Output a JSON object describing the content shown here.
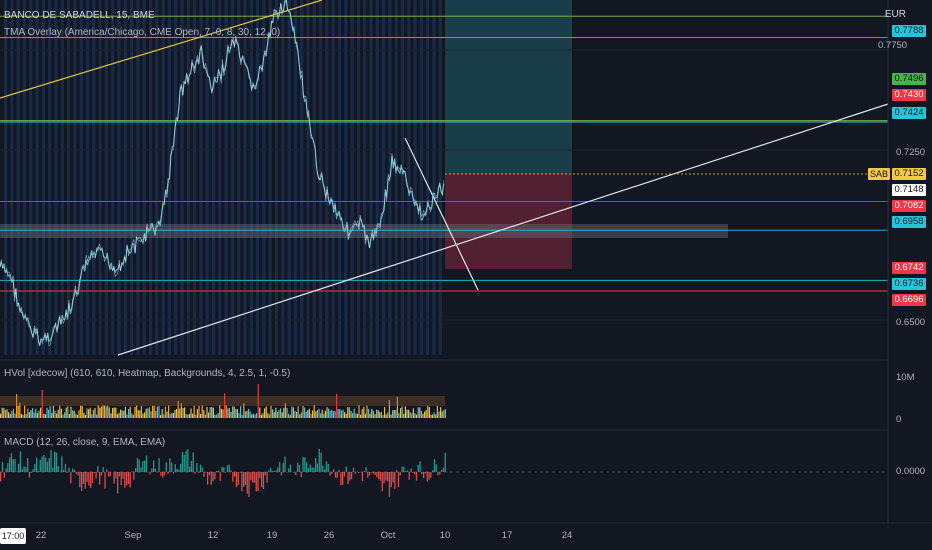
{
  "header": {
    "title": "BANCO DE SABADELL, 15, BME",
    "currency": "EUR"
  },
  "indicators": {
    "tma": "TMA Overlay (America/Chicago, CME Open, 7, 0, 8, 30, 12, 0)",
    "hvol": "HVol [xdecow] (610, 610, Heatmap, Backgrounds, 4, 2.5, 1, -0.5)",
    "macd": "MACD (12, 26, close, 9, EMA, EMA)"
  },
  "price_axis": {
    "ticks": [
      "0.7750",
      "0.7250",
      "0.6500"
    ],
    "badges": [
      {
        "label": "0.7788",
        "color": "#26c6da",
        "price": 0.7788
      },
      {
        "label": "0.7496",
        "color": "#4caf50",
        "price": 0.7496
      },
      {
        "label": "0.7430",
        "color": "#f23645",
        "price": 0.743
      },
      {
        "label": "0.7424",
        "color": "#26c6da",
        "price": 0.7424
      },
      {
        "label": "0.7152",
        "color": "#f5c842",
        "price": 0.7152
      },
      {
        "label": "0.7148",
        "color": "#ffffff",
        "price": 0.7148
      },
      {
        "label": "0.7082",
        "color": "#f23645",
        "price": 0.7082
      },
      {
        "label": "0.6958",
        "color": "#26c6da",
        "price": 0.6958
      },
      {
        "label": "0.6742",
        "color": "#f23645",
        "price": 0.6742
      },
      {
        "label": "0.6736",
        "color": "#26c6da",
        "price": 0.6736
      },
      {
        "label": "0.6696",
        "color": "#f23645",
        "price": 0.6696
      }
    ],
    "symbol_badge": "SAB"
  },
  "hvol_axis": {
    "ticks": [
      "10M",
      "0"
    ]
  },
  "macd_axis": {
    "ticks": [
      "0.0000"
    ]
  },
  "time_axis": {
    "current_time": "17:00",
    "labels": [
      "22",
      "Sep",
      "12",
      "19",
      "26",
      "Oct",
      "10",
      "17",
      "24"
    ]
  },
  "chart_data": {
    "type": "line",
    "title": "BANCO DE SABADELL, 15, BME",
    "price_range": [
      0.642,
      0.795
    ],
    "horizontal_levels": [
      {
        "price": 0.788,
        "color": "#8bc34a"
      },
      {
        "price": 0.7788,
        "color": "#26c6da"
      },
      {
        "price": 0.743,
        "color": "#8bc34a"
      },
      {
        "price": 0.7424,
        "color": "#26c6da"
      },
      {
        "price": 0.7082,
        "color": "#f23645"
      },
      {
        "price": 0.6958,
        "color": "#26c6da"
      },
      {
        "price": 0.6742,
        "color": "#26c6da"
      },
      {
        "price": 0.6696,
        "color": "#f23645"
      }
    ],
    "approx_close_series": [
      0.68,
      0.676,
      0.66,
      0.652,
      0.648,
      0.652,
      0.657,
      0.665,
      0.68,
      0.686,
      0.684,
      0.679,
      0.686,
      0.69,
      0.695,
      0.697,
      0.72,
      0.755,
      0.764,
      0.772,
      0.756,
      0.765,
      0.778,
      0.766,
      0.757,
      0.77,
      0.79,
      0.794,
      0.775,
      0.745,
      0.722,
      0.71,
      0.703,
      0.694,
      0.698,
      0.69,
      0.702,
      0.725,
      0.721,
      0.708,
      0.702,
      0.71,
      0.715
    ]
  }
}
